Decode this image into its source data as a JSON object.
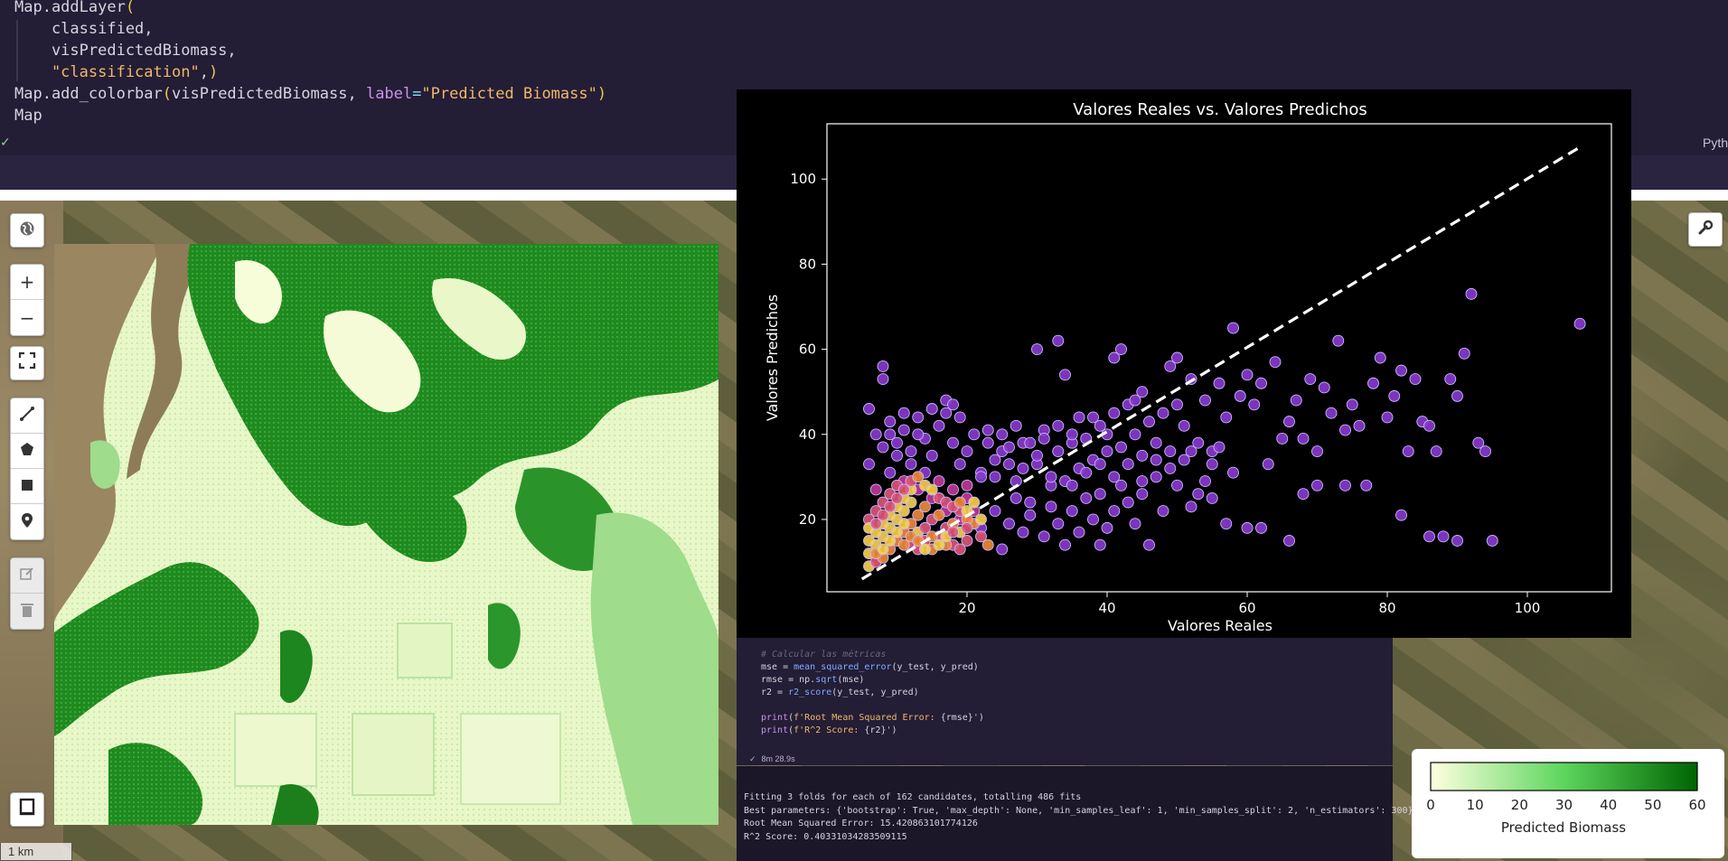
{
  "code_cell": {
    "lines": [
      {
        "tokens": [
          [
            "id",
            "Map.addLayer"
          ],
          [
            "paren",
            "("
          ]
        ]
      },
      {
        "tokens": [
          [
            "id",
            "    classified,"
          ]
        ]
      },
      {
        "tokens": [
          [
            "id",
            "    visPredictedBiomass,"
          ]
        ]
      },
      {
        "tokens": [
          [
            "str",
            "    \"classification\""
          ],
          [
            "id",
            ","
          ],
          [
            "paren",
            ")"
          ]
        ]
      },
      {
        "tokens": [
          [
            "id",
            "Map.add_colorbar"
          ],
          [
            "paren",
            "("
          ],
          [
            "id",
            "visPredictedBiomass, "
          ],
          [
            "kw",
            "label"
          ],
          [
            "op",
            "="
          ],
          [
            "str",
            "\"Predicted Biomass\""
          ],
          [
            "paren",
            ")"
          ]
        ]
      },
      {
        "tokens": [
          [
            "id",
            "Map"
          ]
        ]
      }
    ],
    "check_mark": "✓",
    "language_label": "Pyth"
  },
  "map_controls": {
    "globe_icon": "globe-icon",
    "zoom_in_label": "+",
    "zoom_out_label": "−",
    "fullscreen_icon": "fullscreen-icon",
    "draw_tools": [
      "polyline-icon",
      "polygon-icon",
      "rectangle-icon",
      "marker-icon"
    ],
    "edit_tools": [
      "edit-icon",
      "trash-icon"
    ],
    "layers_icon": "layers-icon",
    "wrench_icon": "wrench-icon",
    "scale_label": "1 km"
  },
  "chart_data": {
    "type": "scatter",
    "title": "Valores Reales vs. Valores Predichos",
    "xlabel": "Valores Reales",
    "ylabel": "Valores Predichos",
    "xlim": [
      0,
      112
    ],
    "ylim": [
      3,
      113
    ],
    "xticks": [
      20,
      40,
      60,
      80,
      100
    ],
    "yticks": [
      20,
      40,
      60,
      80,
      100
    ],
    "reference_line": {
      "x": [
        5,
        107.5
      ],
      "y": [
        6,
        107.5
      ],
      "style": "dashed",
      "color": "#ffffff"
    },
    "grid": false,
    "colormap": "plasma (density)",
    "points": [
      [
        8,
        56
      ],
      [
        8,
        53
      ],
      [
        6,
        46
      ],
      [
        7,
        40
      ],
      [
        9,
        43
      ],
      [
        10,
        38
      ],
      [
        11,
        41
      ],
      [
        12,
        36
      ],
      [
        13,
        44
      ],
      [
        14,
        39
      ],
      [
        15,
        35
      ],
      [
        16,
        42
      ],
      [
        17,
        48
      ],
      [
        18,
        38
      ],
      [
        19,
        33
      ],
      [
        20,
        36
      ],
      [
        21,
        40
      ],
      [
        22,
        31
      ],
      [
        23,
        38
      ],
      [
        24,
        30
      ],
      [
        25,
        36
      ],
      [
        26,
        33
      ],
      [
        27,
        29
      ],
      [
        28,
        38
      ],
      [
        29,
        24
      ],
      [
        30,
        33
      ],
      [
        31,
        41
      ],
      [
        32,
        28
      ],
      [
        33,
        36
      ],
      [
        34,
        29
      ],
      [
        35,
        38
      ],
      [
        36,
        32
      ],
      [
        37,
        39
      ],
      [
        38,
        34
      ],
      [
        39,
        42
      ],
      [
        40,
        36
      ],
      [
        41,
        45
      ],
      [
        42,
        37
      ],
      [
        43,
        47
      ],
      [
        44,
        40
      ],
      [
        45,
        50
      ],
      [
        46,
        43
      ],
      [
        47,
        38
      ],
      [
        48,
        45
      ],
      [
        49,
        56
      ],
      [
        50,
        47
      ],
      [
        51,
        42
      ],
      [
        52,
        53
      ],
      [
        53,
        38
      ],
      [
        54,
        48
      ],
      [
        55,
        36
      ],
      [
        56,
        52
      ],
      [
        57,
        44
      ],
      [
        58,
        65
      ],
      [
        59,
        49
      ],
      [
        60,
        54
      ],
      [
        61,
        47
      ],
      [
        62,
        52
      ],
      [
        63,
        33
      ],
      [
        64,
        57
      ],
      [
        65,
        39
      ],
      [
        66,
        43
      ],
      [
        67,
        48
      ],
      [
        68,
        39
      ],
      [
        69,
        53
      ],
      [
        70,
        36
      ],
      [
        71,
        51
      ],
      [
        72,
        45
      ],
      [
        73,
        62
      ],
      [
        74,
        41
      ],
      [
        75,
        47
      ],
      [
        76,
        42
      ],
      [
        77,
        28
      ],
      [
        78,
        52
      ],
      [
        79,
        58
      ],
      [
        80,
        44
      ],
      [
        81,
        49
      ],
      [
        82,
        55
      ],
      [
        83,
        36
      ],
      [
        84,
        53
      ],
      [
        85,
        43
      ],
      [
        86,
        42
      ],
      [
        87,
        36
      ],
      [
        88,
        16
      ],
      [
        89,
        53
      ],
      [
        90,
        49
      ],
      [
        91,
        59
      ],
      [
        92,
        73
      ],
      [
        93,
        38
      ],
      [
        94,
        36
      ],
      [
        95,
        15
      ],
      [
        107.5,
        66
      ],
      [
        30,
        60
      ],
      [
        33,
        62
      ],
      [
        34,
        54
      ],
      [
        42,
        60
      ],
      [
        18,
        47
      ],
      [
        44,
        48
      ],
      [
        41,
        58
      ],
      [
        50,
        58
      ],
      [
        45,
        35
      ],
      [
        46,
        14
      ],
      [
        39,
        14
      ],
      [
        52,
        23
      ],
      [
        55,
        25
      ],
      [
        57,
        19
      ],
      [
        60,
        18
      ],
      [
        62,
        18
      ],
      [
        66,
        15
      ],
      [
        68,
        26
      ],
      [
        70,
        28
      ],
      [
        74,
        28
      ],
      [
        82,
        21
      ],
      [
        86,
        16
      ],
      [
        90,
        15
      ],
      [
        22,
        18
      ],
      [
        24,
        22
      ],
      [
        25,
        13
      ],
      [
        26,
        19
      ],
      [
        27,
        25
      ],
      [
        28,
        17
      ],
      [
        29,
        21
      ],
      [
        31,
        16
      ],
      [
        32,
        23
      ],
      [
        33,
        19
      ],
      [
        34,
        14
      ],
      [
        35,
        22
      ],
      [
        36,
        17
      ],
      [
        37,
        25
      ],
      [
        38,
        20
      ],
      [
        39,
        26
      ],
      [
        40,
        18
      ],
      [
        41,
        22
      ],
      [
        42,
        28
      ],
      [
        43,
        24
      ],
      [
        44,
        19
      ],
      [
        45,
        26
      ],
      [
        47,
        30
      ],
      [
        48,
        22
      ],
      [
        49,
        32
      ],
      [
        50,
        28
      ],
      [
        51,
        34
      ],
      [
        53,
        26
      ],
      [
        54,
        29
      ],
      [
        55,
        33
      ],
      [
        56,
        37
      ],
      [
        58,
        31
      ],
      [
        17,
        22
      ],
      [
        18,
        27
      ],
      [
        19,
        20
      ],
      [
        20,
        25
      ],
      [
        21,
        22
      ],
      [
        16,
        29
      ],
      [
        15,
        25
      ],
      [
        14,
        31
      ],
      [
        13,
        27
      ],
      [
        12,
        33
      ],
      [
        11,
        29
      ],
      [
        10,
        35
      ],
      [
        9,
        31
      ],
      [
        8,
        37
      ],
      [
        7,
        27
      ],
      [
        6,
        33
      ],
      [
        20,
        28
      ],
      [
        22,
        30
      ],
      [
        24,
        34
      ],
      [
        26,
        37
      ],
      [
        28,
        32
      ],
      [
        30,
        35
      ],
      [
        32,
        30
      ],
      [
        35,
        28
      ],
      [
        37,
        31
      ],
      [
        39,
        33
      ],
      [
        41,
        30
      ],
      [
        43,
        33
      ],
      [
        45,
        29
      ],
      [
        47,
        34
      ],
      [
        49,
        36
      ],
      [
        52,
        36
      ],
      [
        23,
        41
      ],
      [
        25,
        40
      ],
      [
        27,
        42
      ],
      [
        29,
        38
      ],
      [
        31,
        39
      ],
      [
        33,
        42
      ],
      [
        35,
        40
      ],
      [
        36,
        44
      ],
      [
        38,
        44
      ],
      [
        40,
        40
      ],
      [
        19,
        44
      ],
      [
        17,
        45
      ],
      [
        15,
        46
      ],
      [
        13,
        40
      ],
      [
        11,
        45
      ],
      [
        9,
        40
      ]
    ],
    "dense_points": [
      [
        6,
        12
      ],
      [
        7,
        14
      ],
      [
        8,
        16
      ],
      [
        9,
        18
      ],
      [
        10,
        20
      ],
      [
        11,
        22
      ],
      [
        12,
        24
      ],
      [
        6,
        9
      ],
      [
        7,
        10
      ],
      [
        8,
        11
      ],
      [
        9,
        13
      ],
      [
        10,
        15
      ],
      [
        11,
        17
      ],
      [
        12,
        19
      ],
      [
        13,
        21
      ],
      [
        14,
        23
      ],
      [
        6,
        15
      ],
      [
        7,
        17
      ],
      [
        8,
        19
      ],
      [
        9,
        21
      ],
      [
        10,
        23
      ],
      [
        11,
        25
      ],
      [
        12,
        27
      ],
      [
        13,
        17
      ],
      [
        14,
        15
      ],
      [
        15,
        13
      ],
      [
        16,
        16
      ],
      [
        17,
        18
      ],
      [
        18,
        14
      ],
      [
        19,
        17
      ],
      [
        20,
        15
      ],
      [
        21,
        19
      ],
      [
        7,
        12
      ],
      [
        8,
        13
      ],
      [
        9,
        15
      ],
      [
        10,
        17
      ],
      [
        11,
        19
      ],
      [
        12,
        14
      ],
      [
        13,
        13
      ],
      [
        14,
        18
      ],
      [
        15,
        20
      ],
      [
        16,
        21
      ],
      [
        17,
        14
      ],
      [
        18,
        19
      ],
      [
        19,
        22
      ],
      [
        20,
        20
      ],
      [
        22,
        16
      ],
      [
        23,
        14
      ],
      [
        6,
        20
      ],
      [
        7,
        22
      ],
      [
        8,
        24
      ],
      [
        9,
        26
      ],
      [
        10,
        28
      ],
      [
        11,
        27
      ],
      [
        12,
        29
      ],
      [
        13,
        30
      ],
      [
        14,
        28
      ],
      [
        15,
        27
      ],
      [
        16,
        25
      ],
      [
        17,
        24
      ],
      [
        18,
        23
      ],
      [
        19,
        24
      ],
      [
        20,
        22
      ],
      [
        21,
        24
      ],
      [
        6,
        18
      ],
      [
        7,
        19
      ],
      [
        8,
        21
      ],
      [
        9,
        23
      ],
      [
        10,
        25
      ],
      [
        11,
        14
      ],
      [
        12,
        16
      ],
      [
        13,
        15
      ],
      [
        14,
        13
      ],
      [
        15,
        16
      ],
      [
        16,
        14
      ],
      [
        17,
        16
      ],
      [
        18,
        17
      ],
      [
        19,
        13
      ],
      [
        20,
        18
      ],
      [
        22,
        20
      ]
    ]
  },
  "notebook": {
    "code_lines": [
      {
        "tokens": [
          [
            "comment",
            "# Calcular las métricas"
          ]
        ]
      },
      {
        "tokens": [
          [
            "id",
            "mse = "
          ],
          [
            "fn",
            "mean_squared_error"
          ],
          [
            "id",
            "(y_test, y_pred)"
          ]
        ]
      },
      {
        "tokens": [
          [
            "id",
            "rmse = np."
          ],
          [
            "fn",
            "sqrt"
          ],
          [
            "id",
            "(mse)"
          ]
        ]
      },
      {
        "tokens": [
          [
            "id",
            "r2 = "
          ],
          [
            "fn",
            "r2_score"
          ],
          [
            "id",
            "(y_test, y_pred)"
          ]
        ]
      },
      {
        "tokens": [
          [
            "id",
            ""
          ]
        ]
      },
      {
        "tokens": [
          [
            "kw",
            "print"
          ],
          [
            "id",
            "("
          ],
          [
            "str",
            "f'Root Mean Squared Error: "
          ],
          [
            "id",
            "{rmse}"
          ],
          [
            "str",
            "'"
          ],
          [
            "id",
            ")"
          ]
        ]
      },
      {
        "tokens": [
          [
            "kw",
            "print"
          ],
          [
            "id",
            "("
          ],
          [
            "str",
            "f'R^2 Score: "
          ],
          [
            "id",
            "{r2}"
          ],
          [
            "str",
            "'"
          ],
          [
            "id",
            ")"
          ]
        ]
      }
    ],
    "status_check": "✓",
    "status_time": "8m 28.9s",
    "output_lines": [
      "Fitting 3 folds for each of 162 candidates, totalling 486 fits",
      "Best parameters: {'bootstrap': True, 'max_depth': None, 'min_samples_leaf': 1, 'min_samples_split': 2, 'n_estimators': 300}",
      "Root Mean Squared Error: 15.420863101774126",
      "R^2 Score: 0.40331034283509115"
    ]
  },
  "legend": {
    "title": "Predicted Biomass",
    "ticks": [
      "0",
      "10",
      "20",
      "30",
      "40",
      "50",
      "60"
    ],
    "color_low": "#ffffe0",
    "color_mid": "#5cd65c",
    "color_high": "#006400"
  },
  "colors": {
    "background": "#1f1a2e",
    "code_bg": "#231d35",
    "plot_bg": "#000000",
    "point_fill": "#8a3ad0",
    "dense_fill": "#ffb347",
    "classified_low": "#f8fcd8",
    "classified_high": "#1a7f1a"
  }
}
